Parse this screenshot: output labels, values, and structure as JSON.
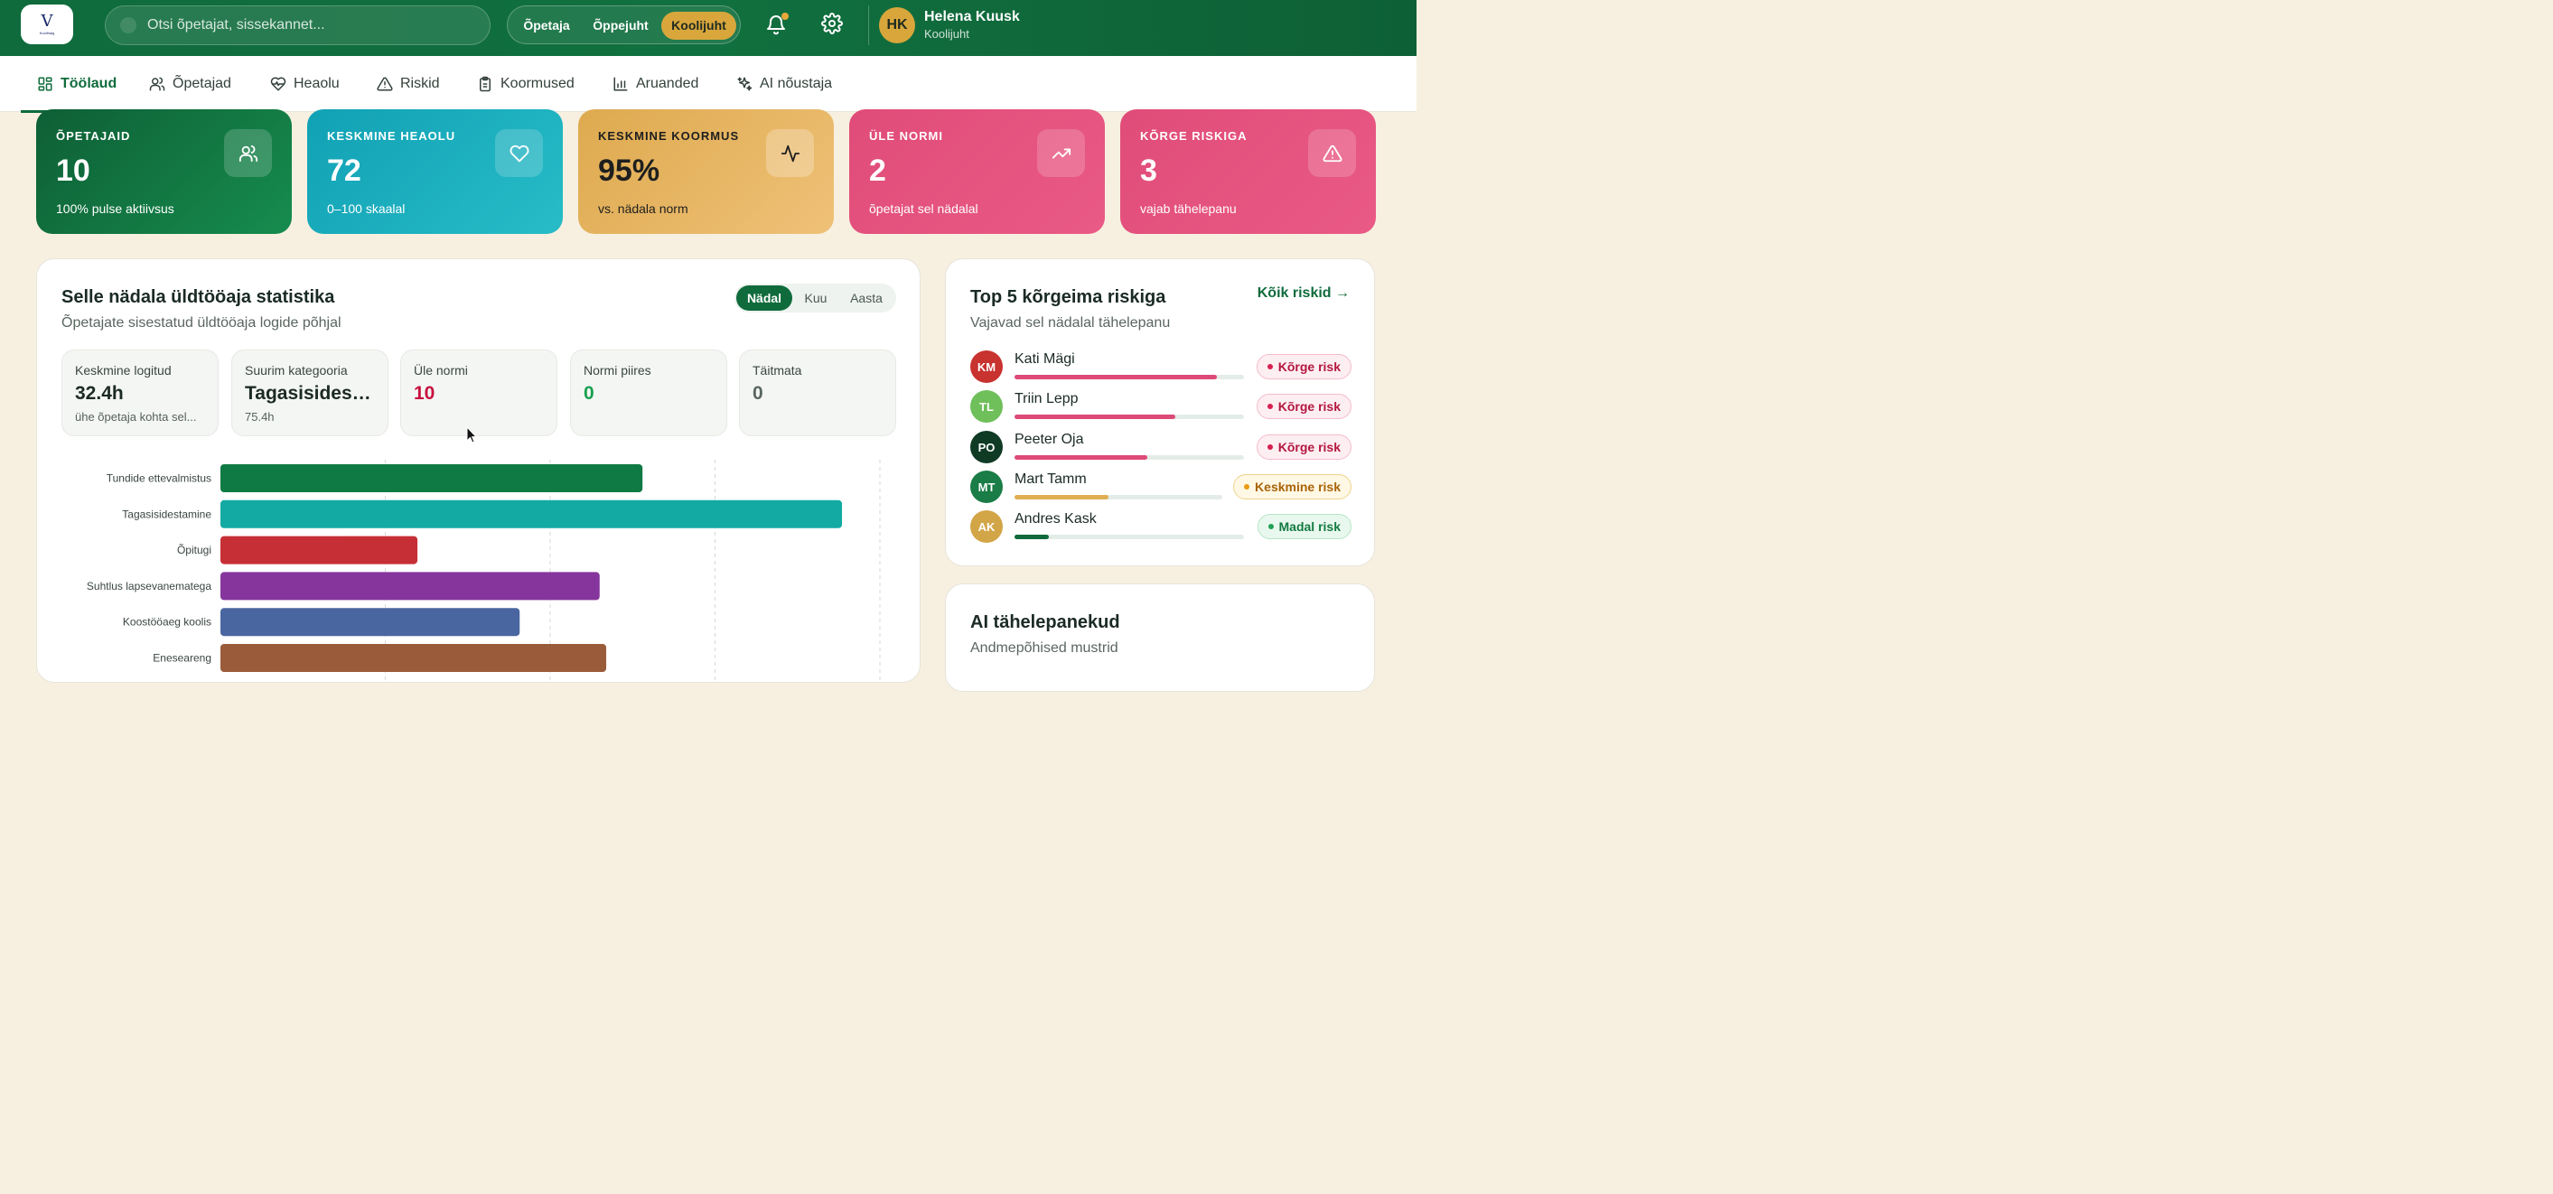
{
  "header": {
    "logo_mark": "V",
    "logo_text": "Koolihaig",
    "search_placeholder": "Otsi õpetajat, sissekannet...",
    "roles": [
      "Õpetaja",
      "Õppejuht",
      "Koolijuht"
    ],
    "active_role": "Koolijuht",
    "user": {
      "initials": "HK",
      "name": "Helena Kuusk",
      "role": "Koolijuht"
    }
  },
  "nav": {
    "items": [
      {
        "label": "Töölaud",
        "icon": "grid-icon",
        "active": true
      },
      {
        "label": "Õpetajad",
        "icon": "users-icon"
      },
      {
        "label": "Heaolu",
        "icon": "heart-pulse-icon"
      },
      {
        "label": "Riskid",
        "icon": "warning-icon"
      },
      {
        "label": "Koormused",
        "icon": "clipboard-icon"
      },
      {
        "label": "Aruanded",
        "icon": "bar-chart-icon"
      },
      {
        "label": "AI nõustaja",
        "icon": "sparkles-icon"
      }
    ]
  },
  "stats": [
    {
      "label": "Õpetajaid",
      "value": "10",
      "sub": "100% pulse aktiivsus",
      "icon": "users-icon"
    },
    {
      "label": "Keskmine heaolu",
      "value": "72",
      "sub": "0–100 skaalal",
      "icon": "heart-icon"
    },
    {
      "label": "Keskmine koormus",
      "value": "95%",
      "sub": "vs. nädala norm",
      "icon": "activity-icon"
    },
    {
      "label": "Üle normi",
      "value": "2",
      "sub": "õpetajat sel nädalal",
      "icon": "trending-up-icon"
    },
    {
      "label": "Kõrge riskiga",
      "value": "3",
      "sub": "vajab tähelepanu",
      "icon": "warning-icon"
    }
  ],
  "workload": {
    "title": "Selle nädala üldtööaja statistika",
    "subtitle": "Õpetajate sisestatud üldtööaja logide põhjal",
    "periods": [
      "Nädal",
      "Kuu",
      "Aasta"
    ],
    "active_period": "Nädal",
    "minis": [
      {
        "label": "Keskmine logitud",
        "value": "32.4h",
        "sub": "ühe õpetaja kohta sel...",
        "color": "#1a2a24"
      },
      {
        "label": "Suurim kategooria",
        "value": "Tagasisidesta...",
        "sub": "75.4h",
        "color": "#1a2a24"
      },
      {
        "label": "Üle normi",
        "value": "10",
        "sub": "",
        "color": "#c8103e"
      },
      {
        "label": "Normi piires",
        "value": "0",
        "sub": "",
        "color": "#18a04f"
      },
      {
        "label": "Täitmata",
        "value": "0",
        "sub": "",
        "color": "#5a6660"
      }
    ]
  },
  "chart_data": {
    "type": "bar",
    "orientation": "horizontal",
    "categories": [
      "Tundide ettevalmistus",
      "Tagasisidestamine",
      "Õpitugi",
      "Suhtlus lapsevanematega",
      "Koostööaeg koolis",
      "Eneseareng"
    ],
    "values": [
      51.2,
      75.4,
      23.9,
      46.0,
      36.3,
      46.8
    ],
    "colors": [
      "#0f7a43",
      "#12aaa3",
      "#c62f35",
      "#86359c",
      "#4a66a0",
      "#9a5b3a"
    ],
    "xlim": [
      0,
      80
    ],
    "grid": true,
    "title": "",
    "xlabel": "",
    "ylabel": ""
  },
  "risks": {
    "title": "Top 5 kõrgeima riskiga",
    "subtitle": "Vajavad sel nädalal tähelepanu",
    "link": "Kõik riskid →",
    "items": [
      {
        "initials": "KM",
        "name": "Kati Mägi",
        "level": 0.88,
        "badge": "Kõrge risk",
        "kind": "high",
        "avatar": "#c8322f",
        "bar": "#de4a78"
      },
      {
        "initials": "TL",
        "name": "Triin Lepp",
        "level": 0.7,
        "badge": "Kõrge risk",
        "kind": "high",
        "avatar": "#6fbf5a",
        "bar": "#de4a78"
      },
      {
        "initials": "PO",
        "name": "Peeter Oja",
        "level": 0.58,
        "badge": "Kõrge risk",
        "kind": "high",
        "avatar": "#0f3a24",
        "bar": "#de4a78"
      },
      {
        "initials": "MT",
        "name": "Mart Tamm",
        "level": 0.45,
        "badge": "Keskmine risk",
        "kind": "mid",
        "avatar": "#1a7c46",
        "bar": "#e0ae52"
      },
      {
        "initials": "AK",
        "name": "Andres Kask",
        "level": 0.15,
        "badge": "Madal risk",
        "kind": "low",
        "avatar": "#d2a547",
        "bar": "#0f6b3c"
      }
    ]
  },
  "ai": {
    "title": "AI tähelepanekud",
    "subtitle": "Andmepõhised mustrid"
  }
}
